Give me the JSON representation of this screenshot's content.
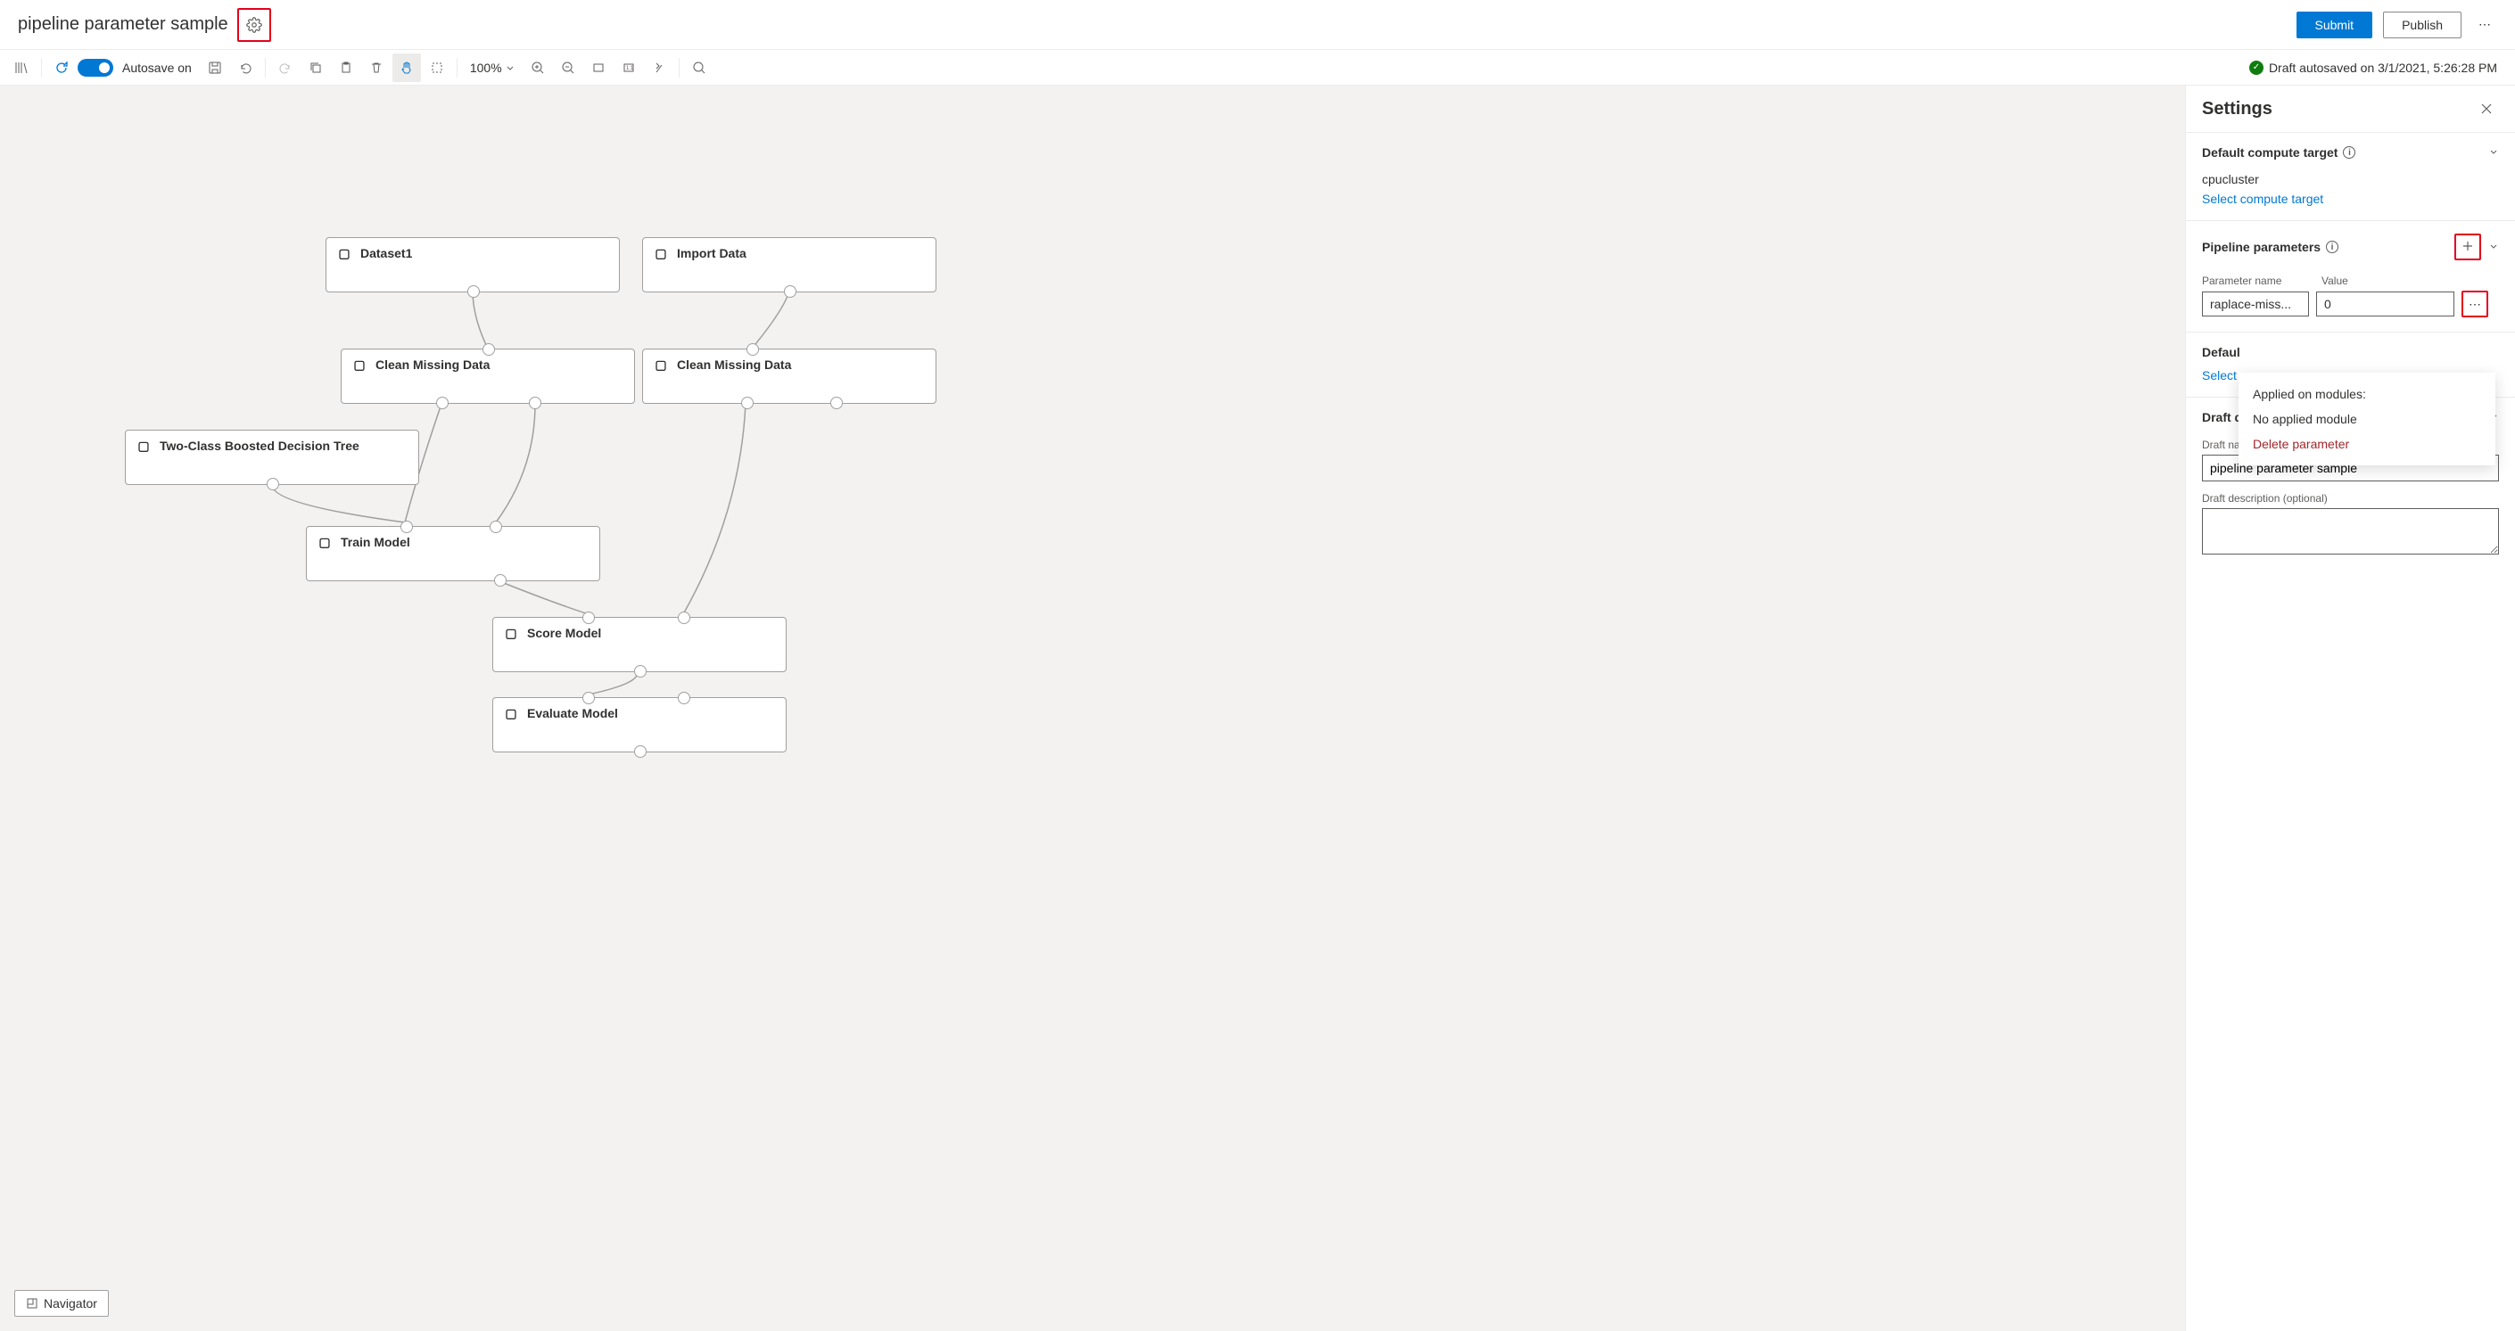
{
  "header": {
    "title": "pipeline parameter sample",
    "submit_label": "Submit",
    "publish_label": "Publish"
  },
  "toolbar": {
    "autosave_label": "Autosave on",
    "zoom": "100%",
    "status": "Draft autosaved on 3/1/2021, 5:26:28 PM"
  },
  "nodes": {
    "dataset1": "Dataset1",
    "import_data": "Import Data",
    "clean1": "Clean Missing Data",
    "clean2": "Clean Missing Data",
    "twoclass": "Two-Class Boosted Decision Tree",
    "train": "Train Model",
    "score": "Score Model",
    "evaluate": "Evaluate Model"
  },
  "navigator": "Navigator",
  "panel": {
    "title": "Settings",
    "compute": {
      "title": "Default compute target",
      "value": "cpucluster",
      "link": "Select compute target"
    },
    "params": {
      "title": "Pipeline parameters",
      "name_label": "Parameter name",
      "value_label": "Value",
      "param_name": "raplace-miss...",
      "param_value": "0"
    },
    "dropdown": {
      "applied_title": "Applied on modules:",
      "applied_none": "No applied module",
      "delete": "Delete parameter"
    },
    "datastore": {
      "title_truncated": "Defaul",
      "link_truncated": "Select"
    },
    "draft": {
      "title": "Draft details",
      "name_label": "Draft name",
      "name_value": "pipeline parameter sample",
      "desc_label": "Draft description (optional)"
    }
  }
}
